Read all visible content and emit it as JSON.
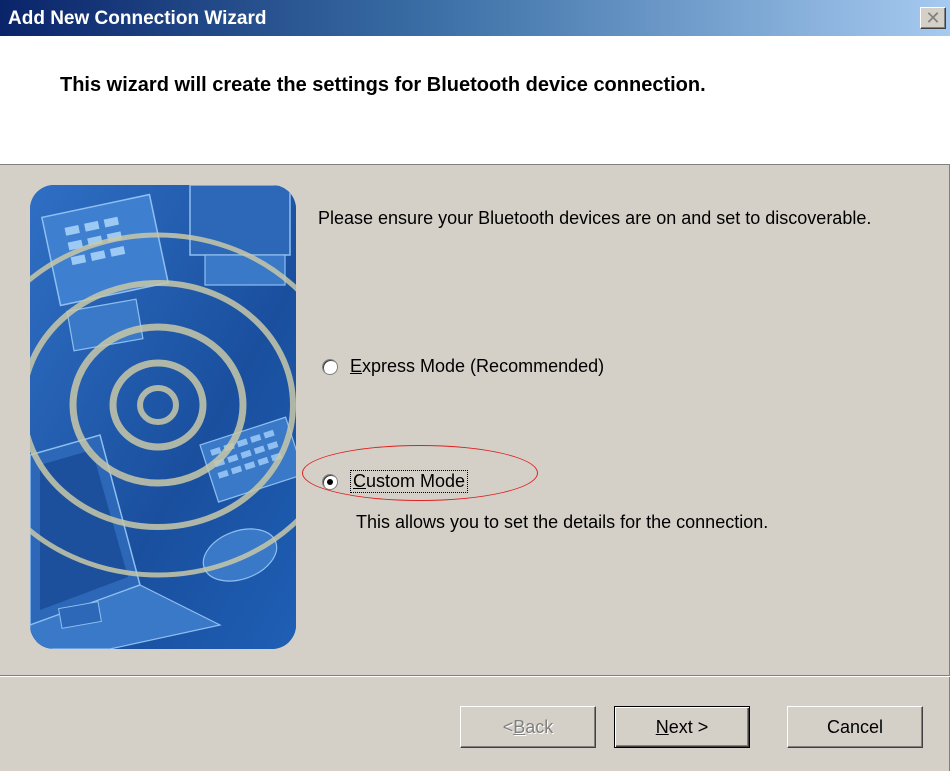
{
  "window": {
    "title": "Add New Connection Wizard",
    "close_symbol": "✕"
  },
  "header": {
    "text": "This wizard will create the settings for Bluetooth device connection."
  },
  "main": {
    "intro": "Please ensure your Bluetooth devices are on and set to discoverable.",
    "options": [
      {
        "label_prefix": "",
        "access_key": "E",
        "label_rest": "xpress Mode (Recommended)",
        "selected": false
      },
      {
        "label_prefix": "",
        "access_key": "C",
        "label_rest": "ustom Mode",
        "selected": true,
        "description": "This allows you to set the details for the connection."
      }
    ]
  },
  "buttons": {
    "back_prefix": "< ",
    "back_key": "B",
    "back_rest": "ack",
    "back_enabled": false,
    "next_key": "N",
    "next_rest": "ext >",
    "cancel": "Cancel"
  },
  "colors": {
    "titlebar_start": "#0a246a",
    "titlebar_end": "#a6caf0",
    "dialog_bg": "#d4d0c8",
    "annotation": "#e02020",
    "illustration_bg": "#1a54a8"
  },
  "icons": [
    "close-icon",
    "bluetooth-devices-illustration",
    "radio-unchecked",
    "radio-checked"
  ]
}
